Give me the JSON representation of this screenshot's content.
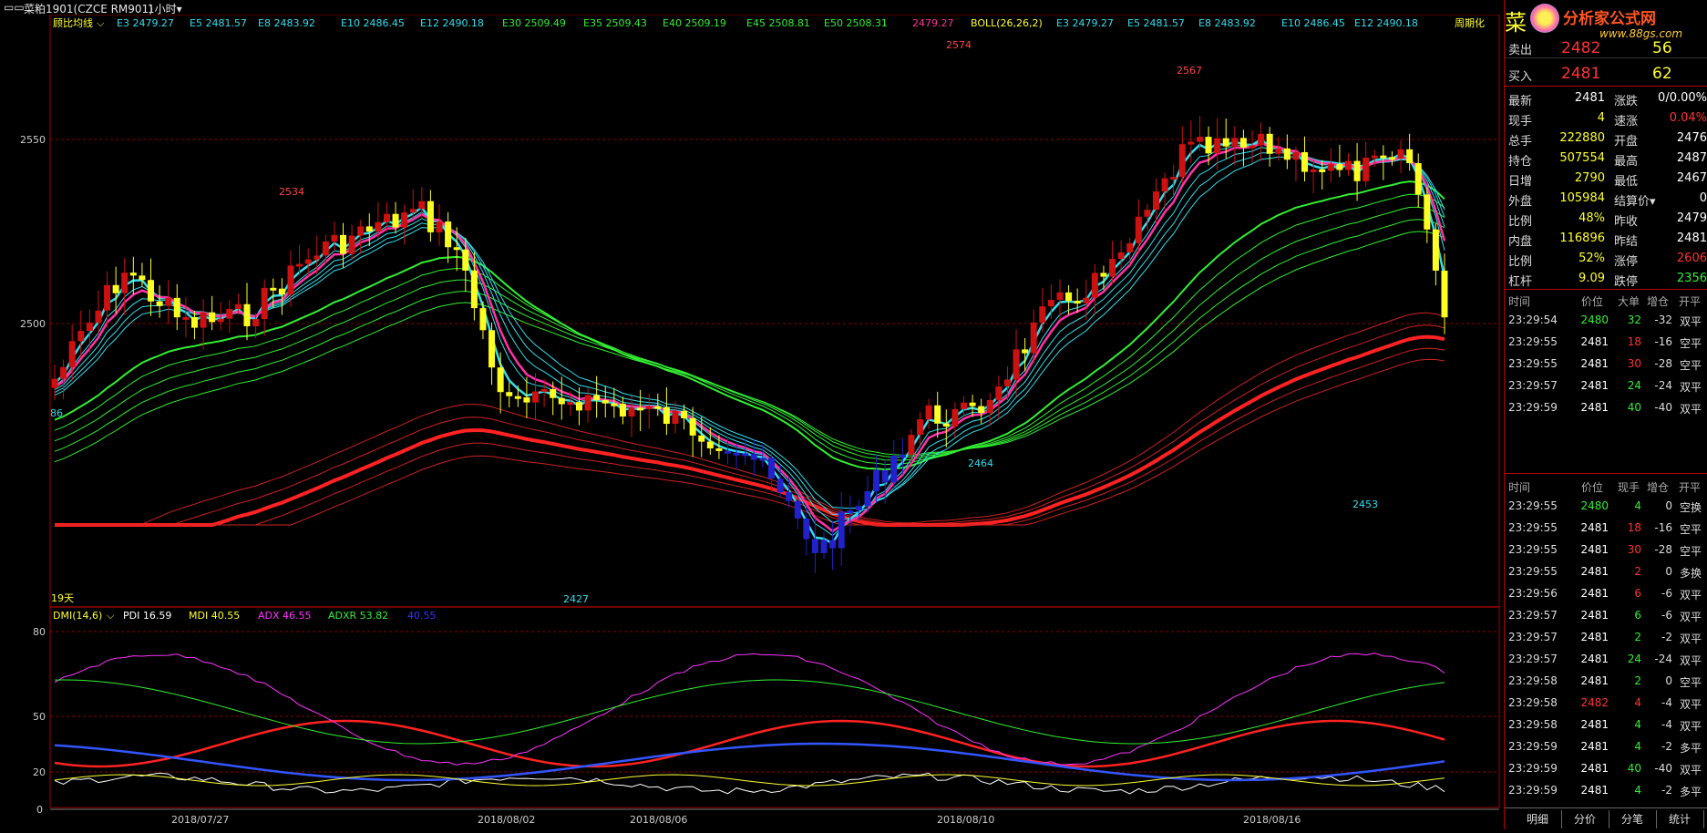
{
  "topbar": {
    "symbol": "菜粕1901(CZCE RM901)",
    "period": "1小时",
    "period_arrow": "▾"
  },
  "main": {
    "indicator_name": "顾比均线",
    "legend": [
      {
        "label": "E3 2479.27",
        "color": "#33ddee"
      },
      {
        "label": "E5 2481.57",
        "color": "#33ddee"
      },
      {
        "label": "E8 2483.92",
        "color": "#33ddee"
      },
      {
        "label": "E10 2486.45",
        "color": "#33ddee"
      },
      {
        "label": "E12 2490.18",
        "color": "#33ddee"
      },
      {
        "label": "E30 2509.49",
        "color": "#33ee33"
      },
      {
        "label": "E35 2509.43",
        "color": "#33ee33"
      },
      {
        "label": "E40 2509.19",
        "color": "#33ee33"
      },
      {
        "label": "E45 2508.81",
        "color": "#33ee33"
      },
      {
        "label": "E50 2508.31",
        "color": "#33ee33"
      },
      {
        "label": "2479.27",
        "color": "#ff3399"
      },
      {
        "label": "BOLL(26,26,2)",
        "color": "#ffff33"
      },
      {
        "label": "E3 2479.27",
        "color": "#33ddee"
      },
      {
        "label": "E5 2481.57",
        "color": "#33ddee"
      },
      {
        "label": "E8 2483.92",
        "color": "#33ddee"
      },
      {
        "label": "E10 2486.45",
        "color": "#33ddee"
      },
      {
        "label": "E12 2490.18",
        "color": "#33ddee"
      }
    ],
    "periodic_label": "周期化",
    "price_ticks": [
      "2550",
      "2500"
    ],
    "days_label": "19天",
    "left_value_label": "86",
    "annotations": [
      {
        "text": "2534",
        "color": "#ff4444"
      },
      {
        "text": "2574",
        "color": "#ff4444"
      },
      {
        "text": "2567",
        "color": "#ff4444"
      },
      {
        "text": "2427",
        "color": "#33ddee"
      },
      {
        "text": "2464",
        "color": "#33ddee"
      },
      {
        "text": "2453",
        "color": "#33ddee"
      }
    ]
  },
  "dmi": {
    "name": "DMI(14,6)",
    "legend": [
      {
        "label": "PDI 16.59",
        "color": "#ffffff"
      },
      {
        "label": "MDI 40.55",
        "color": "#ffff33"
      },
      {
        "label": "ADX 46.55",
        "color": "#ff33ff"
      },
      {
        "label": "ADXR 53.82",
        "color": "#33ee33"
      },
      {
        "label": "40.55",
        "color": "#3333ff"
      }
    ],
    "ticks": [
      "80",
      "50",
      "20",
      "0"
    ]
  },
  "x_axis": [
    "2018/07/27",
    "2018/08/02",
    "2018/08/06",
    "2018/08/10",
    "2018/08/16"
  ],
  "right_panel": {
    "logo_text": "分析家公式网",
    "logo_url": "www.88gs.com",
    "title_char": "菜",
    "sell": {
      "label": "卖出",
      "price": "2482",
      "vol": "56"
    },
    "buy": {
      "label": "买入",
      "price": "2481",
      "vol": "62"
    },
    "quotes": [
      {
        "l1": "最新",
        "v1": "2481",
        "c1": "#ffffff",
        "l2": "涨跌",
        "v2": "0/0.00%",
        "c2": "#ffffff"
      },
      {
        "l1": "现手",
        "v1": "4",
        "c1": "#ffff33",
        "l2": "速涨",
        "v2": "0.04%",
        "c2": "#ff3333"
      },
      {
        "l1": "总手",
        "v1": "222880",
        "c1": "#ffff33",
        "l2": "开盘",
        "v2": "2476",
        "c2": "#ffffff"
      },
      {
        "l1": "持仓",
        "v1": "507554",
        "c1": "#ffff33",
        "l2": "最高",
        "v2": "2487",
        "c2": "#ffffff"
      },
      {
        "l1": "日增",
        "v1": "2790",
        "c1": "#ffff33",
        "l2": "最低",
        "v2": "2467",
        "c2": "#ffffff"
      },
      {
        "l1": "外盘",
        "v1": "105984",
        "c1": "#ffff33",
        "l2": "结算价▾",
        "v2": "0",
        "c2": "#ffffff"
      },
      {
        "l1": "比例",
        "v1": "48%",
        "c1": "#ffff33",
        "l2": "昨收",
        "v2": "2479",
        "c2": "#ffffff"
      },
      {
        "l1": "内盘",
        "v1": "116896",
        "c1": "#ffff33",
        "l2": "昨结",
        "v2": "2481",
        "c2": "#ffffff"
      },
      {
        "l1": "比例",
        "v1": "52%",
        "c1": "#ffff33",
        "l2": "涨停",
        "v2": "2606",
        "c2": "#ff3333"
      },
      {
        "l1": "杠杆",
        "v1": "9.09",
        "c1": "#ffff33",
        "l2": "跌停",
        "v2": "2356",
        "c2": "#33ee33"
      }
    ],
    "ticks1_header": [
      "时间",
      "价位",
      "大单",
      "增仓",
      "开平"
    ],
    "ticks1": [
      {
        "t": "23:29:54",
        "p": "2480",
        "pc": "#33ee33",
        "v": "32",
        "vc": "#33ee33",
        "d": "-32",
        "o": "双平"
      },
      {
        "t": "23:29:55",
        "p": "2481",
        "pc": "#ffffff",
        "v": "18",
        "vc": "#ff3333",
        "d": "-16",
        "o": "空平"
      },
      {
        "t": "23:29:55",
        "p": "2481",
        "pc": "#ffffff",
        "v": "30",
        "vc": "#ff3333",
        "d": "-28",
        "o": "空平"
      },
      {
        "t": "23:29:57",
        "p": "2481",
        "pc": "#ffffff",
        "v": "24",
        "vc": "#33ee33",
        "d": "-24",
        "o": "双平"
      },
      {
        "t": "23:29:59",
        "p": "2481",
        "pc": "#ffffff",
        "v": "40",
        "vc": "#33ee33",
        "d": "-40",
        "o": "双平"
      }
    ],
    "ticks2_header": [
      "时间",
      "价位",
      "现手",
      "增仓",
      "开平"
    ],
    "ticks2": [
      {
        "t": "23:29:55",
        "p": "2480",
        "pc": "#33ee33",
        "v": "4",
        "vc": "#33ee33",
        "d": "0",
        "o": "空换"
      },
      {
        "t": "23:29:55",
        "p": "2481",
        "pc": "#ffffff",
        "v": "18",
        "vc": "#ff3333",
        "d": "-16",
        "o": "空平"
      },
      {
        "t": "23:29:55",
        "p": "2481",
        "pc": "#ffffff",
        "v": "30",
        "vc": "#ff3333",
        "d": "-28",
        "o": "空平"
      },
      {
        "t": "23:29:55",
        "p": "2481",
        "pc": "#ffffff",
        "v": "2",
        "vc": "#ff3333",
        "d": "0",
        "o": "多换"
      },
      {
        "t": "23:29:56",
        "p": "2481",
        "pc": "#ffffff",
        "v": "6",
        "vc": "#ff3333",
        "d": "-6",
        "o": "双平"
      },
      {
        "t": "23:29:57",
        "p": "2481",
        "pc": "#ffffff",
        "v": "6",
        "vc": "#33ee33",
        "d": "-6",
        "o": "双平"
      },
      {
        "t": "23:29:57",
        "p": "2481",
        "pc": "#ffffff",
        "v": "2",
        "vc": "#33ee33",
        "d": "-2",
        "o": "双平"
      },
      {
        "t": "23:29:57",
        "p": "2481",
        "pc": "#ffffff",
        "v": "24",
        "vc": "#33ee33",
        "d": "-24",
        "o": "双平"
      },
      {
        "t": "23:29:58",
        "p": "2481",
        "pc": "#ffffff",
        "v": "2",
        "vc": "#33ee33",
        "d": "0",
        "o": "空平"
      },
      {
        "t": "23:29:58",
        "p": "2482",
        "pc": "#ff3333",
        "v": "4",
        "vc": "#ff3333",
        "d": "-4",
        "o": "双平"
      },
      {
        "t": "23:29:58",
        "p": "2481",
        "pc": "#ffffff",
        "v": "4",
        "vc": "#33ee33",
        "d": "-4",
        "o": "双平"
      },
      {
        "t": "23:29:59",
        "p": "2481",
        "pc": "#ffffff",
        "v": "4",
        "vc": "#33ee33",
        "d": "-2",
        "o": "多平"
      },
      {
        "t": "23:29:59",
        "p": "2481",
        "pc": "#ffffff",
        "v": "40",
        "vc": "#33ee33",
        "d": "-40",
        "o": "双平"
      },
      {
        "t": "23:29:59",
        "p": "2481",
        "pc": "#ffffff",
        "v": "4",
        "vc": "#33ee33",
        "d": "-2",
        "o": "多平"
      }
    ],
    "tabs": [
      "明细",
      "分价",
      "分笔",
      "统计"
    ]
  }
}
